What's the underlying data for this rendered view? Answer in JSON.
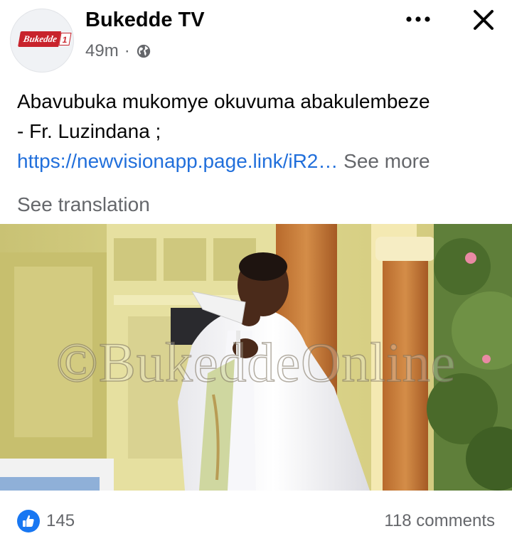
{
  "post": {
    "page_name": "Bukedde TV",
    "logo_word": "Bukedde",
    "logo_number": "1",
    "time": "49m",
    "separator": "·",
    "privacy_icon": "globe-icon",
    "text_line1": "Abavubuka mukomye okuvuma abakulembeze",
    "text_line2": "- Fr. Luzindana ;",
    "link": "https://newvisionapp.page.link/iR2…",
    "see_more": "See more",
    "see_translation": "See translation",
    "watermark": "©BukeddeOnline"
  },
  "footer": {
    "reaction_icon": "like-icon",
    "reaction_count": "145",
    "comments": "118 comments"
  },
  "colors": {
    "link": "#216fdb",
    "secondary_text": "#65676b",
    "like_blue": "#1877f2",
    "brand_red": "#c8232c"
  }
}
